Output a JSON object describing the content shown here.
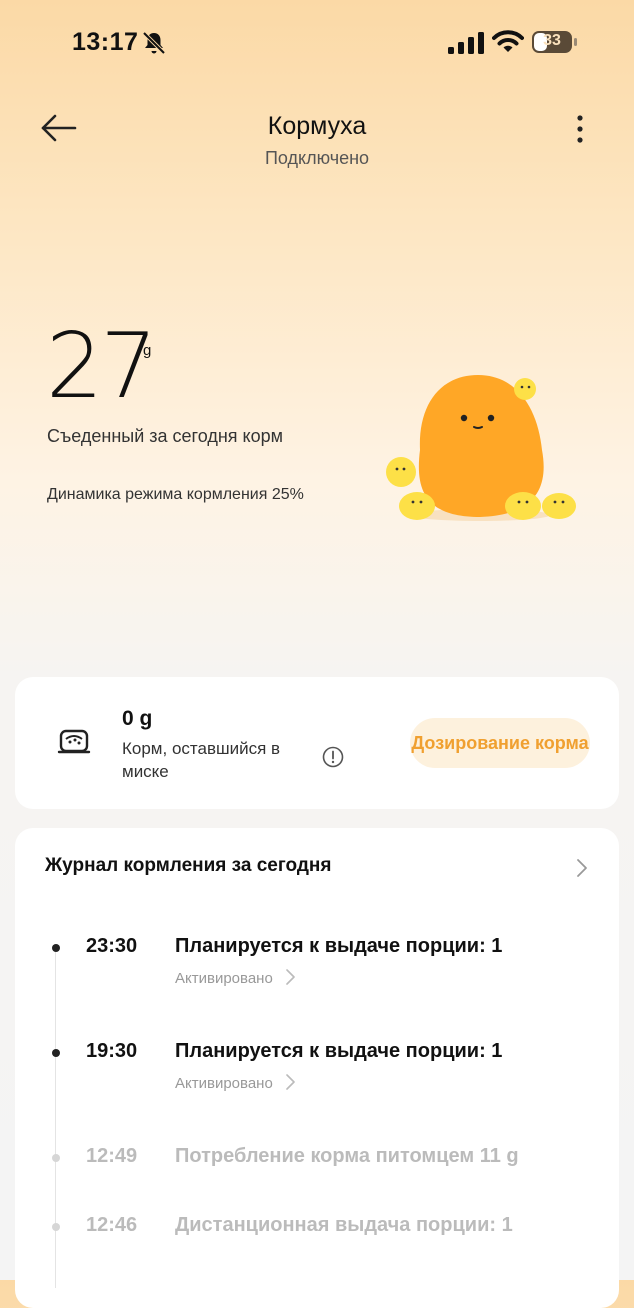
{
  "status_bar": {
    "time": "13:17",
    "battery": "33"
  },
  "header": {
    "title": "Кормуха",
    "subtitle": "Подключено"
  },
  "hero": {
    "eaten_value": "27",
    "eaten_unit": "g",
    "eaten_label": "Съеденный за сегодня корм",
    "mode_label": "Динамика режима кормления 25%"
  },
  "bowl": {
    "value": "0 g",
    "description": "Корм, оставшийся в миске",
    "dose_button": "Дозирование корма"
  },
  "journal": {
    "title": "Журнал кормления за сегодня",
    "entries": [
      {
        "time": "23:30",
        "title": "Планируется к выдаче порции: 1",
        "status": "Активировано"
      },
      {
        "time": "19:30",
        "title": "Планируется к выдаче порции: 1",
        "status": "Активировано"
      },
      {
        "time": "12:49",
        "title": "Потребление корма питомцем 11 g"
      },
      {
        "time": "12:46",
        "title": "Дистанционная выдача порции: 1"
      }
    ]
  },
  "colors": {
    "accent": "#f0a030",
    "mascot": "#ffa726",
    "chick": "#fdd835"
  }
}
